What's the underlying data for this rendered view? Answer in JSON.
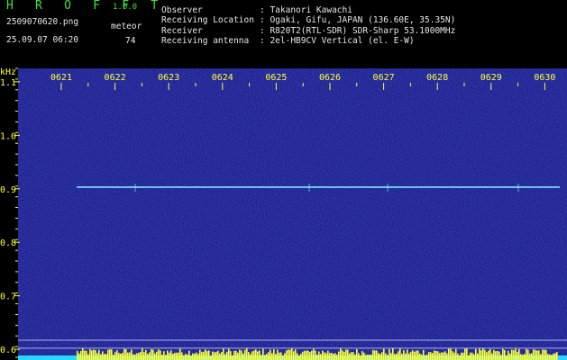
{
  "header": {
    "brand": "H R O F F T",
    "version": "1.0.0",
    "filename": "2509070620.png",
    "datetime": "25.09.07 06:20",
    "meteor_label": "meteor",
    "meteor_count": "74"
  },
  "info": [
    {
      "label": "Observer",
      "value": ": Takanori Kawachi"
    },
    {
      "label": "Receiving Location",
      "value": ": Ogaki, Gifu, JAPAN (136.60E, 35.35N)"
    },
    {
      "label": "Receiver",
      "value": ": R820T2(RTL-SDR) SDR-Sharp 53.1000MHz"
    },
    {
      "label": "Receiving antenna",
      "value": ": 2el-HB9CV Vertical (el. E-W)"
    }
  ],
  "spectrogram": {
    "unit_label": "kHz",
    "time_ticks": [
      "0621",
      "0622",
      "0623",
      "0624",
      "0625",
      "0626",
      "0627",
      "0628",
      "0629",
      "0630"
    ],
    "freq_ticks": [
      "1.1",
      "1.0",
      "0.9",
      "0.8",
      "0.7",
      "0.6"
    ],
    "freq_values": [
      1.1,
      1.0,
      0.9,
      0.8,
      0.7,
      0.6
    ],
    "freq_range": [
      0.58,
      1.125
    ],
    "carrier_freq": 0.903,
    "carrier_time_start_fraction": 0.107,
    "reference_line_freqs": [
      0.617,
      0.602
    ],
    "colors": {
      "background": "#1a1e8a",
      "tick_color": "#ffff3a",
      "carrier": "#7fe8ff",
      "reference_lines": "#c8c8ff",
      "level_fill": "#ffff3a",
      "level_baseline": "#29d8ff"
    }
  }
}
